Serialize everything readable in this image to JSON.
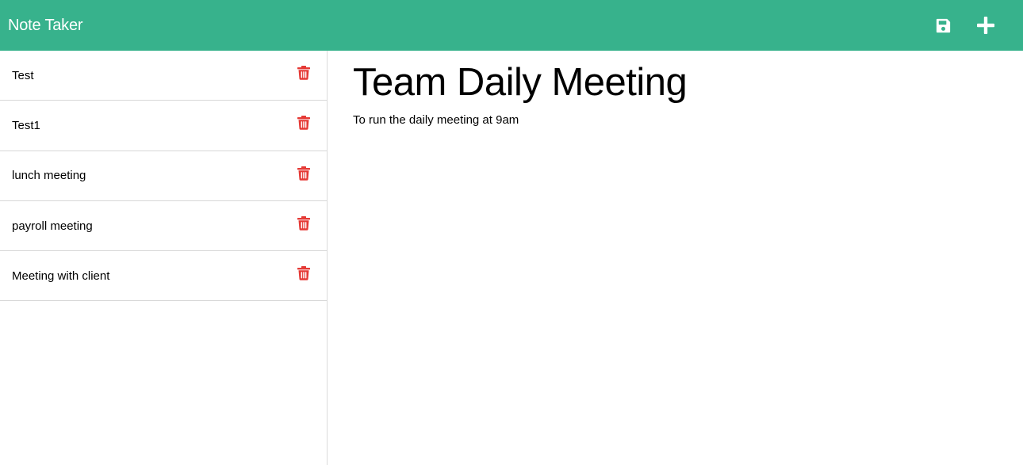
{
  "navbar": {
    "title": "Note Taker",
    "save_icon": "floppy-disk-icon",
    "add_icon": "plus-icon"
  },
  "sidebar": {
    "items": [
      {
        "label": "Test"
      },
      {
        "label": "Test1"
      },
      {
        "label": "lunch meeting"
      },
      {
        "label": "payroll meeting"
      },
      {
        "label": "Meeting with client"
      }
    ],
    "delete_icon": "trash-icon"
  },
  "main": {
    "note_title": "Team Daily Meeting",
    "note_text": "To run the daily meeting at 9am"
  },
  "colors": {
    "navbar": "#37b28c",
    "delete": "#e53935",
    "icon": "#ffffff"
  }
}
